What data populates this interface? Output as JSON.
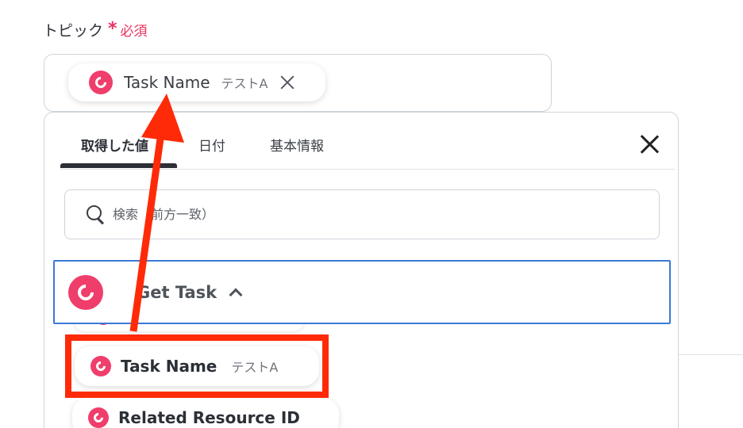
{
  "field": {
    "label": "トピック",
    "required_mark": "*",
    "required_text": "必須"
  },
  "selected_chip": {
    "name": "Task Name",
    "value": "テストA",
    "icon": "app-logo-icon"
  },
  "panel": {
    "tabs": [
      {
        "label": "取得した値",
        "active": true
      },
      {
        "label": "日付",
        "active": false
      },
      {
        "label": "基本情報",
        "active": false
      }
    ],
    "search": {
      "placeholder": "検索（前方一致）",
      "value": ""
    },
    "group": {
      "title": "Get Task",
      "expanded": true
    },
    "items": [
      {
        "name": "Task Name",
        "value": "テストA"
      },
      {
        "name": "Related Resource ID",
        "value": ""
      }
    ]
  },
  "annotation": {
    "color": "#ff2a07",
    "highlighted_item": "Task Name"
  },
  "colors": {
    "accent": "#ef3e6b",
    "required": "#e9325f",
    "focus_border": "#3b79d6",
    "annotation": "#ff2a07"
  }
}
